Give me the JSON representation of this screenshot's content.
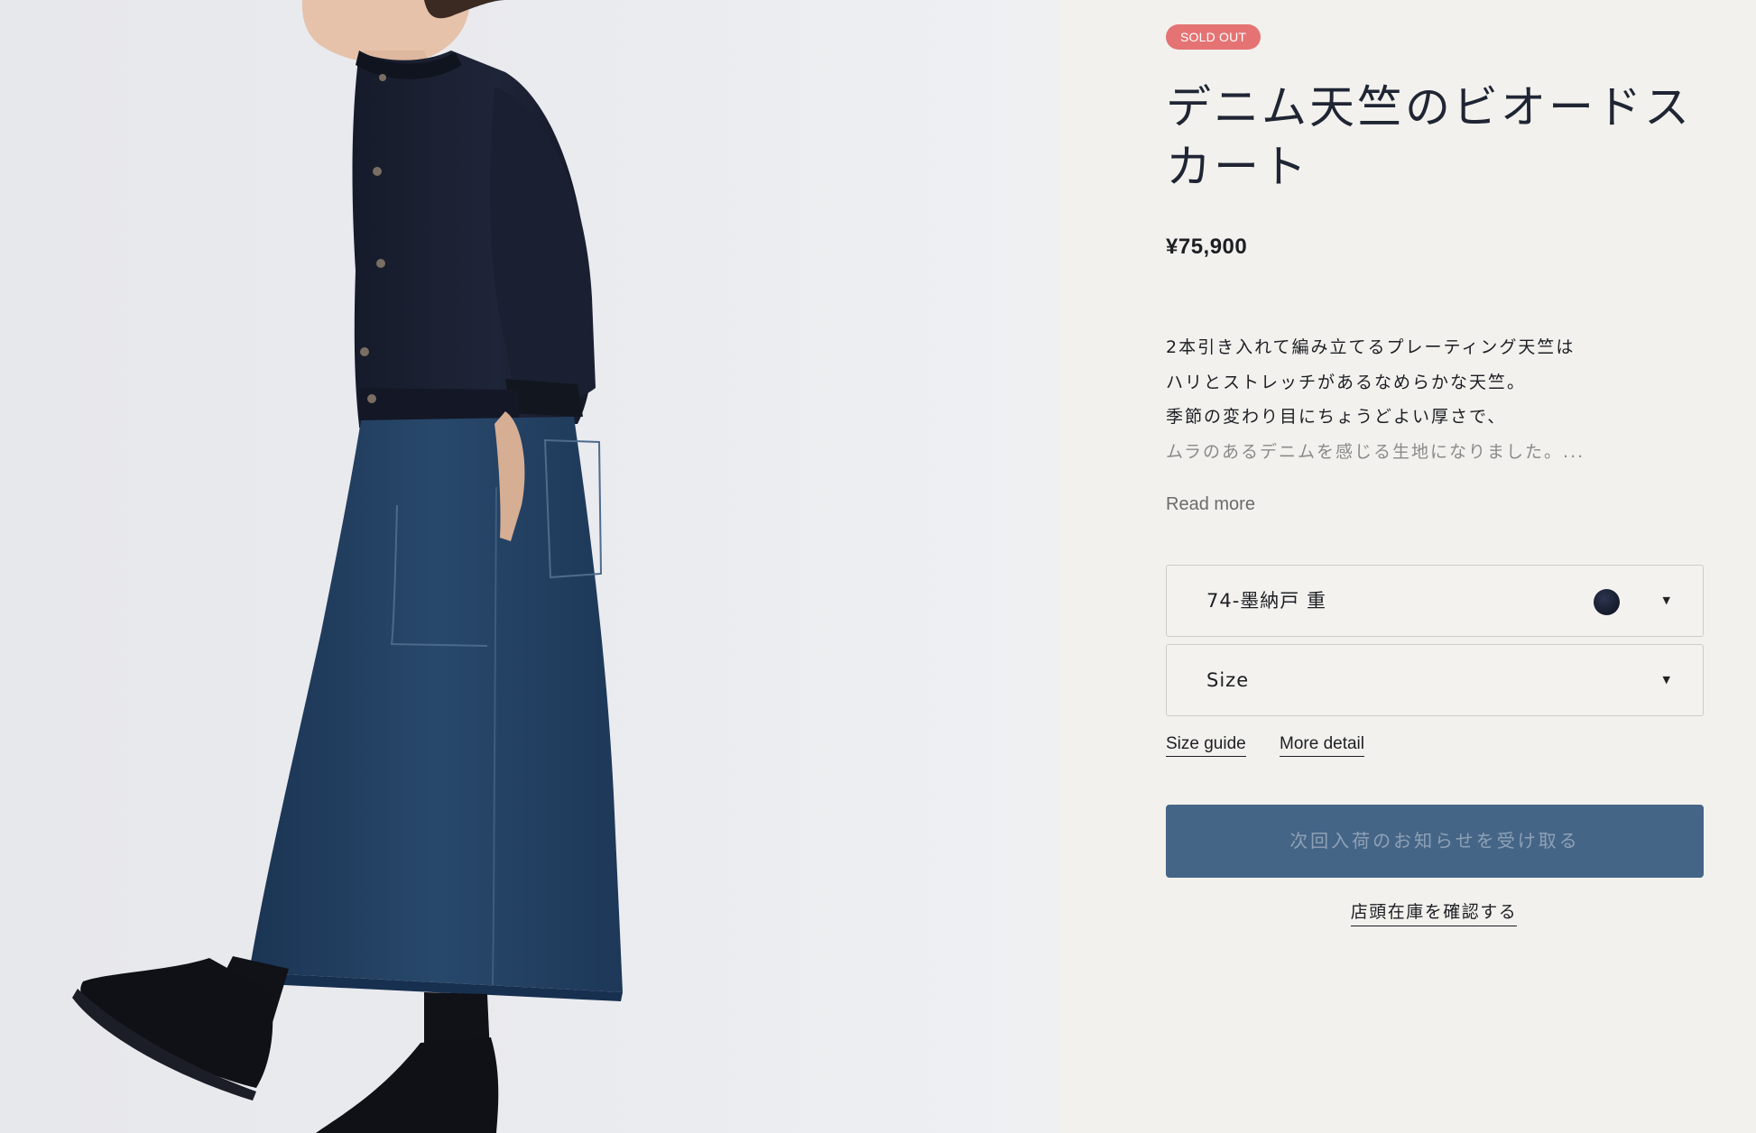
{
  "product": {
    "badge": "SOLD OUT",
    "title_lines": [
      "デニム天竺のビオードス",
      "カート"
    ],
    "price": "¥75,900",
    "description_lines": [
      "2本引き入れて編み立てるプレーティング天竺は",
      "ハリとストレッチがあるなめらかな天竺。",
      "季節の変わり目にちょうどよい厚さで、",
      "ムラのあるデニムを感じる生地になりました。..."
    ],
    "read_more": "Read more",
    "photo_alt": "model wearing navy cardigan, indigo denim skirt and black high-top sneakers"
  },
  "selectors": {
    "color_value": "74-墨納戸 重",
    "color_swatch": "#1a2033",
    "size_placeholder": "Size",
    "caret": "▼"
  },
  "links": {
    "size_guide": "Size guide",
    "more_detail": "More detail"
  },
  "actions": {
    "notify": "次回入荷のお知らせを受け取る",
    "store_check": "店頭在庫を確認する"
  },
  "colors": {
    "badge": "#e57373",
    "notify_button": "#456587",
    "background": "#f2f1ed"
  }
}
